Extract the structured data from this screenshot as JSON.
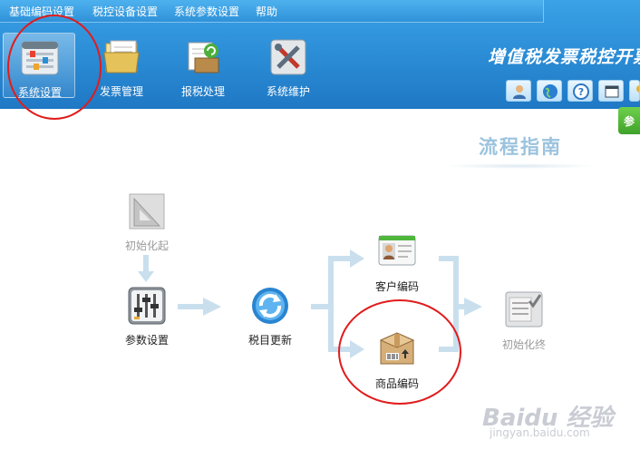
{
  "menu": {
    "items": [
      "基础编码设置",
      "税控设备设置",
      "系统参数设置",
      "帮助"
    ]
  },
  "toolbar": {
    "items": [
      {
        "label": "系统设置",
        "icon": "settings-icon",
        "active": true
      },
      {
        "label": "发票管理",
        "icon": "folder-icon",
        "active": false
      },
      {
        "label": "报税处理",
        "icon": "tax-box-icon",
        "active": false
      },
      {
        "label": "系统维护",
        "icon": "tools-icon",
        "active": false
      }
    ]
  },
  "brand": {
    "title": "增值税发票税控开票软"
  },
  "status_buttons": [
    "user-icon",
    "globe-icon",
    "help-icon",
    "window-icon",
    "key-icon"
  ],
  "side_tab": {
    "label": "参"
  },
  "flow": {
    "title": "流程指南",
    "nodes": {
      "init_start": "初始化起",
      "params": "参数设置",
      "tax_update": "税目更新",
      "customer_code": "客户编码",
      "product_code": "商品编码",
      "init_end": "初始化终"
    }
  },
  "watermark": {
    "logo": "Baidu 经验",
    "url": "jingyan.baidu.com"
  },
  "colors": {
    "header_blue": "#2d8fd8",
    "arrow_blue": "#c9dfee",
    "annotation_red": "#e11c1c",
    "side_tab_green": "#4db234"
  }
}
